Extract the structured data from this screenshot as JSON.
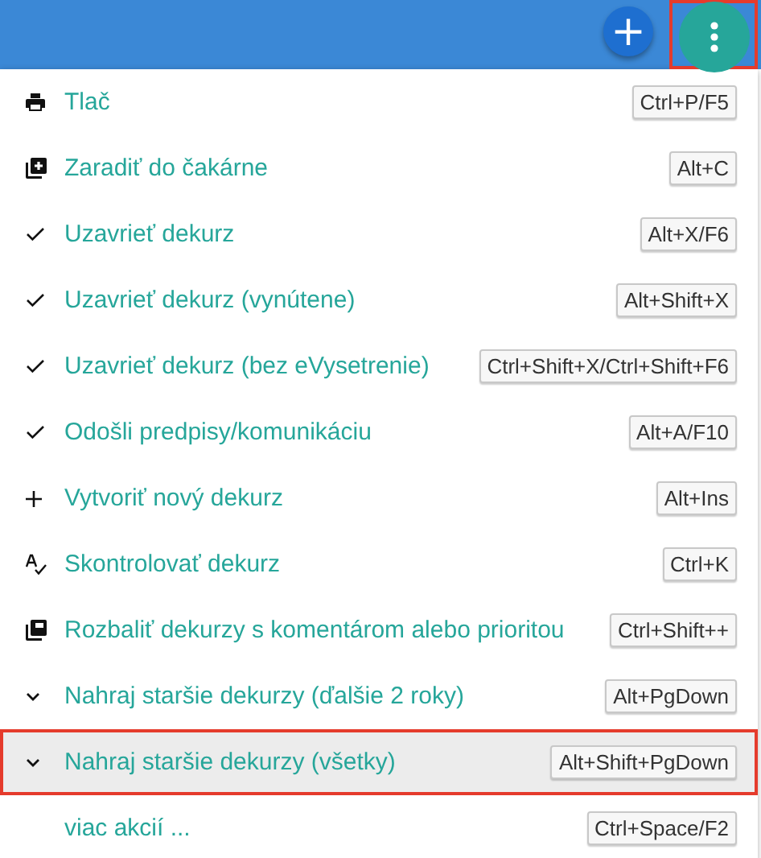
{
  "toolbar": {
    "add_button": {
      "label": "+"
    },
    "more_button": {
      "highlighted": true
    }
  },
  "menu": {
    "items": [
      {
        "kind": "print",
        "label": "Tlač",
        "shortcut": "Ctrl+P/F5",
        "selected": false
      },
      {
        "kind": "queue",
        "label": "Zaradiť do čakárne",
        "shortcut": "Alt+C",
        "selected": false
      },
      {
        "kind": "check",
        "label": "Uzavrieť dekurz",
        "shortcut": "Alt+X/F6",
        "selected": false
      },
      {
        "kind": "check",
        "label": "Uzavrieť dekurz (vynútene)",
        "shortcut": "Alt+Shift+X",
        "selected": false
      },
      {
        "kind": "check",
        "label": "Uzavrieť dekurz (bez eVysetrenie)",
        "shortcut": "Ctrl+Shift+X/Ctrl+Shift+F6",
        "selected": false
      },
      {
        "kind": "check",
        "label": "Odošli predpisy/komunikáciu",
        "shortcut": "Alt+A/F10",
        "selected": false
      },
      {
        "kind": "plus",
        "label": "Vytvoriť nový dekurz",
        "shortcut": "Alt+Ins",
        "selected": false
      },
      {
        "kind": "spellcheck",
        "label": "Skontrolovať dekurz",
        "shortcut": "Ctrl+K",
        "selected": false
      },
      {
        "kind": "library",
        "label": "Rozbaliť dekurzy s komentárom alebo prioritou",
        "shortcut": "Ctrl+Shift++",
        "selected": false
      },
      {
        "kind": "chevron",
        "label": "Nahraj staršie dekurzy (ďalšie 2 roky)",
        "shortcut": "Alt+PgDown",
        "selected": false
      },
      {
        "kind": "chevron",
        "label": "Nahraj staršie dekurzy (všetky)",
        "shortcut": "Alt+Shift+PgDown",
        "selected": true
      },
      {
        "kind": "plain",
        "label": "viac akcií ...",
        "shortcut": "Ctrl+Space/F2",
        "selected": false
      }
    ]
  }
}
